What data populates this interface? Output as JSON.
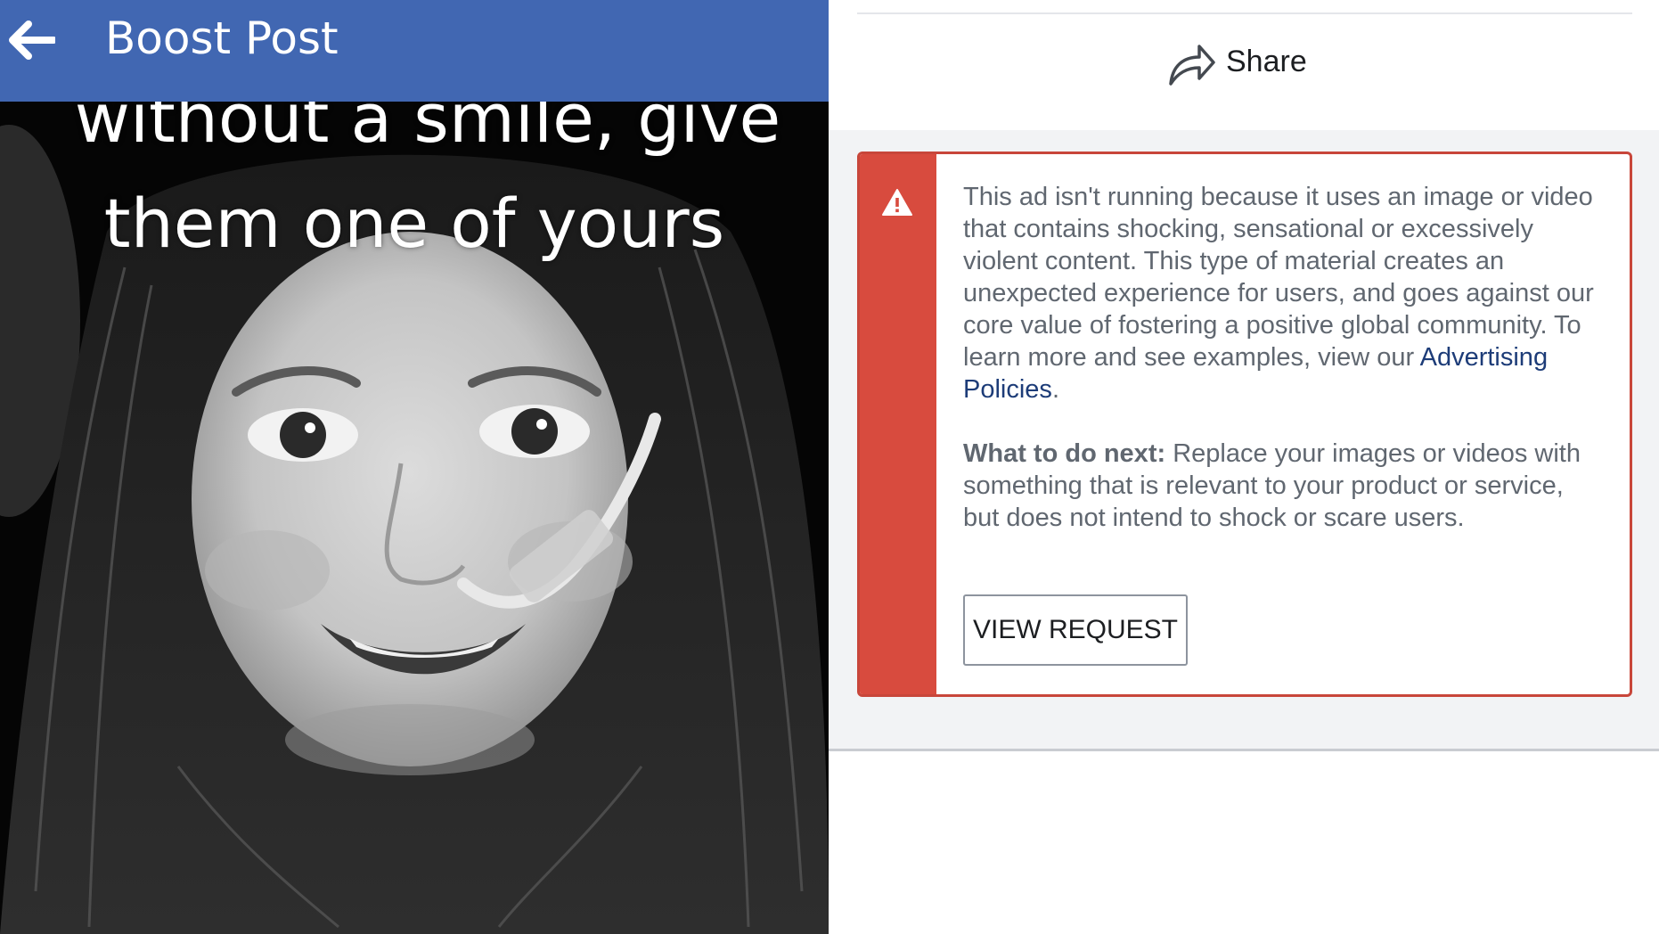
{
  "header": {
    "title": "Boost Post",
    "back_icon": "arrow-left-icon",
    "background_color": "#4167b2"
  },
  "post_image": {
    "caption_line_1": "without a smile, give",
    "caption_line_2": "them one of yours"
  },
  "share": {
    "label": "Share",
    "icon": "share-arrow-icon"
  },
  "alert": {
    "icon": "warning-triangle-icon",
    "accent_color": "#d84b3e",
    "message_text": "This ad isn't running because it uses an image or video that contains shocking, sensational or excessively violent content. This type of material creates an unexpected experience for users, and goes against our core value of fostering a positive global community. To learn more and see examples, view our ",
    "policy_link_label": "Advertising Policies",
    "message_end": ".",
    "next_label": "What to do next:",
    "next_text": " Replace your images or videos with something that is relevant to your product or service, but does not intend to shock or scare users.",
    "link_color": "#1d3c78"
  },
  "view_request": {
    "label": "VIEW REQUEST"
  }
}
